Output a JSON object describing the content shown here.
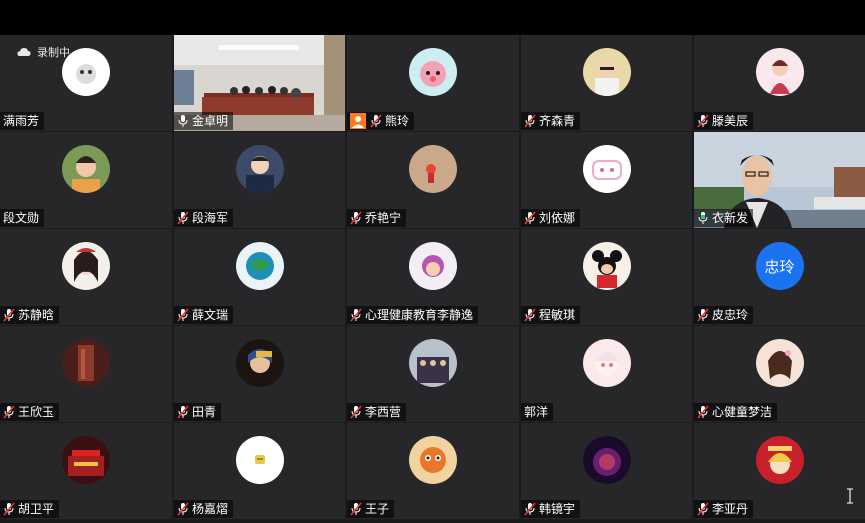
{
  "recording": {
    "label": "录制中"
  },
  "tiles": [
    {
      "name": "满雨芳",
      "mic": false
    },
    {
      "name": "金卓明",
      "mic": "on"
    },
    {
      "name": "熊玲",
      "mic": "muted",
      "host": true
    },
    {
      "name": "齐森青",
      "mic": "muted"
    },
    {
      "name": "滕美辰",
      "mic": "muted"
    },
    {
      "name": "段文勋",
      "mic": false
    },
    {
      "name": "段海军",
      "mic": "muted"
    },
    {
      "name": "乔艳宁",
      "mic": "muted"
    },
    {
      "name": "刘依娜",
      "mic": "muted"
    },
    {
      "name": "衣新发",
      "mic": "on"
    },
    {
      "name": "苏静晗",
      "mic": "muted"
    },
    {
      "name": "薛文瑞",
      "mic": "muted"
    },
    {
      "name": "心理健康教育李静逸",
      "mic": "muted"
    },
    {
      "name": "程敏琪",
      "mic": "muted"
    },
    {
      "name": "皮忠玲",
      "mic": "muted"
    },
    {
      "name": "王欣玉",
      "mic": "muted"
    },
    {
      "name": "田青",
      "mic": "muted"
    },
    {
      "name": "李西营",
      "mic": "muted"
    },
    {
      "name": "郭洋",
      "mic": false
    },
    {
      "name": "心健童梦洁",
      "mic": "muted"
    },
    {
      "name": "胡卫平",
      "mic": "muted"
    },
    {
      "name": "杨嘉熠",
      "mic": "muted"
    },
    {
      "name": "王子",
      "mic": "muted"
    },
    {
      "name": "韩镜宇",
      "mic": "muted"
    },
    {
      "name": "李亚丹",
      "mic": "muted"
    }
  ],
  "avatar_text": {
    "pi": "忠玲"
  },
  "colors": {
    "mic_muted": "#e53935",
    "host_badge": "#ff7a1a",
    "avatar_blue": "#1a73f0"
  }
}
